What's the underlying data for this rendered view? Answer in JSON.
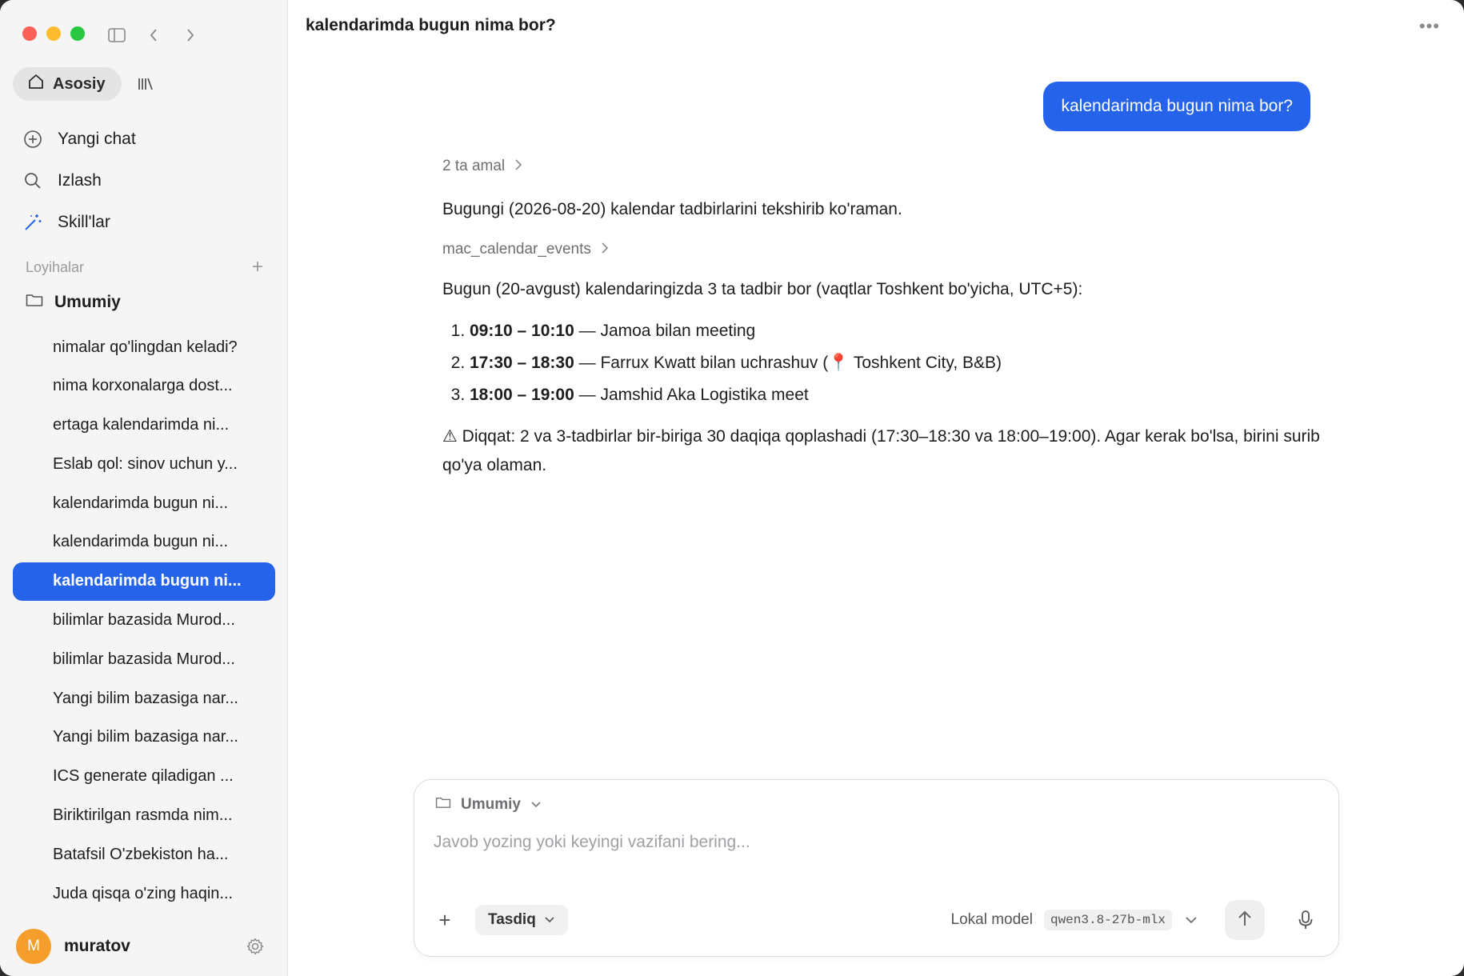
{
  "sidebar": {
    "tabs": {
      "home_label": "Asosiy"
    },
    "nav": {
      "new_chat": "Yangi chat",
      "search": "Izlash",
      "skills": "Skill'lar"
    },
    "projects_label": "Loyihalar",
    "folder_name": "Umumiy",
    "chats": [
      "nimalar qo'lingdan keladi?",
      "nima korxonalarga dost...",
      "ertaga kalendarimda ni...",
      "Eslab qol: sinov uchun y...",
      "kalendarimda bugun ni...",
      "kalendarimda bugun ni...",
      "kalendarimda bugun ni...",
      "bilimlar bazasida Murod...",
      "bilimlar bazasida Murod...",
      "Yangi bilim bazasiga nar...",
      "Yangi bilim bazasiga nar...",
      "ICS generate qiladigan ...",
      "Biriktirilgan rasmda nim...",
      "Batafsil O'zbekiston ha...",
      "Juda qisqa o'zing haqin..."
    ],
    "active_chat_index": 6,
    "user": {
      "initial": "M",
      "name": "muratov"
    }
  },
  "main": {
    "title": "kalendarimda bugun nima bor?",
    "more": "•••",
    "user_message": "kalendarimda bugun nima bor?",
    "actions_label": "2 ta amal",
    "intro": "Bugungi (2026-08-20) kalendar tadbirlarini tekshirib ko'raman.",
    "tool_name": "mac_calendar_events",
    "summary": "Bugun (20-avgust) kalendaringizda 3 ta tadbir bor (vaqtlar Toshkent bo'yicha, UTC+5):",
    "events": [
      {
        "time": "09:10 – 10:10",
        "text": " — Jamoa bilan meeting"
      },
      {
        "time": "17:30 – 18:30",
        "text": " — Farrux Kwatt bilan uchrashuv (📍 Toshkent City, B&B)"
      },
      {
        "time": "18:00 – 19:00",
        "text": " — Jamshid Aka Logistika meet"
      }
    ],
    "warning": "⚠ Diqqat: 2 va 3-tadbirlar bir-biriga 30 daqiqa qoplashadi (17:30–18:30 va 18:00–19:00). Agar kerak bo'lsa, birini surib qo'ya olaman."
  },
  "composer": {
    "folder": "Umumiy",
    "placeholder": "Javob yozing yoki keyingi vazifani bering...",
    "mode": "Tasdiq",
    "model_label": "Lokal model",
    "model_code": "qwen3.8-27b-mlx"
  },
  "colors": {
    "accent": "#2563eb",
    "avatar": "#f59e2b"
  }
}
